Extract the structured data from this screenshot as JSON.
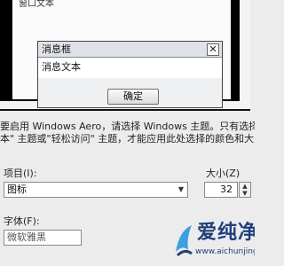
{
  "preview": {
    "window_text": "窗口文本",
    "message_box": {
      "title": "消息框",
      "message": "消息文本",
      "ok_label": "确定"
    }
  },
  "description": {
    "line1": "要启用 Windows Aero，请选择 Windows 主题。只有选择",
    "line2": "本\" 主题或\"轻松访问\" 主题，才能应用此处选择的颜色和大"
  },
  "item": {
    "label": "项目(I):",
    "value": "图标"
  },
  "size": {
    "label": "大小(Z)",
    "value": "32"
  },
  "font": {
    "label": "字体(F):",
    "value": "微软雅黑"
  },
  "watermark": {
    "title": "爱纯净",
    "url": "www.aichunjing.com"
  },
  "colors": {
    "background": "#ececec",
    "watermark": "#1f3f7a",
    "watermark_accent": "#3aa0e0"
  }
}
